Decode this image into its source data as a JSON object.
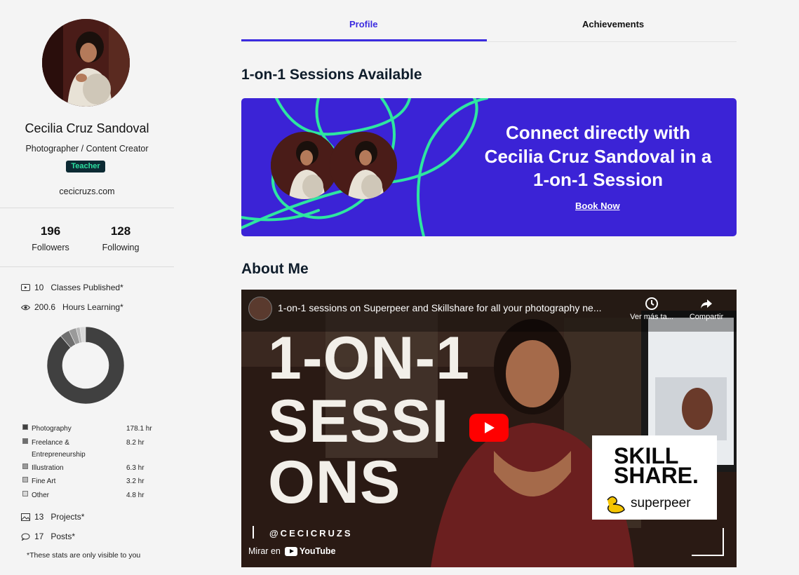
{
  "sidebar": {
    "profile_name": "Cecilia Cruz Sandoval",
    "role": "Photographer / Content Creator",
    "badge": "Teacher",
    "website": "cecicruzs.com",
    "followers_count": "196",
    "followers_label": "Followers",
    "following_count": "128",
    "following_label": "Following",
    "classes_count": "10",
    "classes_label": "Classes Published*",
    "hours_count": "200.6",
    "hours_label": "Hours Learning*",
    "learning": [
      {
        "label": "Photography",
        "hours": "178.1 hr",
        "color": "#404040"
      },
      {
        "label": "Freelance & Entrepreneurship",
        "hours": "8.2 hr",
        "color": "#6f6f6f"
      },
      {
        "label": "Illustration",
        "hours": "6.3 hr",
        "color": "#9a9a9a"
      },
      {
        "label": "Fine Art",
        "hours": "3.2 hr",
        "color": "#b9b9b9"
      },
      {
        "label": "Other",
        "hours": "4.8 hr",
        "color": "#d8d8d8"
      }
    ],
    "projects_count": "13",
    "projects_label": "Projects*",
    "posts_count": "17",
    "posts_label": "Posts*",
    "stats_note": "*These stats are only visible to you"
  },
  "tabs": [
    {
      "label": "Profile",
      "active": true
    },
    {
      "label": "Achievements",
      "active": false
    }
  ],
  "sessions": {
    "title": "1-on-1 Sessions Available",
    "banner_line1": "Connect directly with",
    "banner_line2": "Cecilia Cruz Sandoval in a",
    "banner_line3": "1-on-1 Session",
    "book_label": "Book Now"
  },
  "about": {
    "title": "About Me",
    "video_title": "1-on-1 sessions on Superpeer and Skillshare for all your photography ne...",
    "watch_later": "Ver más ta...",
    "share": "Compartir",
    "overlay_line1": "1-ON-1",
    "overlay_line2": "SESSI",
    "overlay_line3": "ONS",
    "skill_line1": "SKILL",
    "skill_line2": "SHARE.",
    "superpeer": "superpeer",
    "handle": "@CECICRUZS",
    "watch_on": "Mirar en",
    "youtube": "YouTube"
  },
  "colors": {
    "accent": "#3b2be0",
    "banner_bg": "#3b23d6",
    "banner_lines": "#2ee6a0",
    "badge_bg": "#0c2a33",
    "badge_text": "#2cdfa0"
  }
}
